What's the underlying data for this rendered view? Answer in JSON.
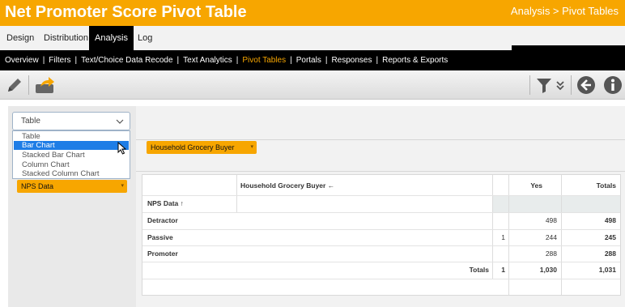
{
  "header": {
    "title": "Net Promoter Score Pivot Table",
    "breadcrumb": "Analysis > Pivot Tables"
  },
  "tabs": [
    {
      "label": "Design",
      "active": false
    },
    {
      "label": "Distribution",
      "active": false
    },
    {
      "label": "Analysis",
      "active": true
    },
    {
      "label": "Log",
      "active": false
    }
  ],
  "subnav": [
    {
      "label": "Overview",
      "active": false
    },
    {
      "label": "Filters",
      "active": false
    },
    {
      "label": "Text/Choice Data Recode",
      "active": false
    },
    {
      "label": "Text Analytics",
      "active": false
    },
    {
      "label": "Pivot Tables",
      "active": true
    },
    {
      "label": "Portals",
      "active": false
    },
    {
      "label": "Responses",
      "active": false
    },
    {
      "label": "Reports & Exports",
      "active": false
    }
  ],
  "toolbar": {
    "left_icons": [
      "pencil-icon",
      "share-export-icon"
    ],
    "right_icons": [
      "filter-icon",
      "double-chevron-down-icon",
      "back-arrow-icon",
      "info-icon"
    ]
  },
  "chart_type_select": {
    "value": "Table",
    "options": [
      "Table",
      "Bar Chart",
      "Stacked Bar Chart",
      "Column Chart",
      "Stacked Column Chart"
    ],
    "highlighted": "Bar Chart"
  },
  "row_field": "NPS Data",
  "column_field": "Household Grocery Buyer",
  "pivot": {
    "column_header": "Household Grocery Buyer ←",
    "row_header": "NPS Data ↑",
    "columns": [
      "",
      "Yes",
      "Totals"
    ],
    "rows": [
      {
        "label": "Detractor",
        "values": [
          "",
          "498",
          "498"
        ]
      },
      {
        "label": "Passive",
        "values": [
          "1",
          "244",
          "245"
        ]
      },
      {
        "label": "Promoter",
        "values": [
          "",
          "288",
          "288"
        ]
      }
    ],
    "totals": {
      "label": "Totals",
      "values": [
        "1",
        "1,030",
        "1,031"
      ]
    }
  },
  "colors": {
    "accent": "#f7a600",
    "selection": "#1e7de6",
    "nav": "#000000"
  }
}
